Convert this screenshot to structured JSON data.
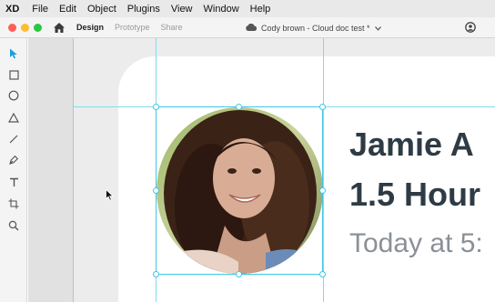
{
  "menubar": {
    "app": "XD",
    "items": [
      "File",
      "Edit",
      "Object",
      "Plugins",
      "View",
      "Window",
      "Help"
    ]
  },
  "header": {
    "tabs": [
      {
        "label": "Design",
        "active": true
      },
      {
        "label": "Prototype",
        "active": false
      },
      {
        "label": "Share",
        "active": false
      }
    ],
    "document_title": "Cody brown - Cloud doc test *"
  },
  "tools": [
    "select-tool",
    "rectangle-tool",
    "ellipse-tool",
    "polygon-tool",
    "line-tool",
    "pen-tool",
    "text-tool",
    "artboard-tool",
    "zoom-tool"
  ],
  "canvas": {
    "title_line1": "Jamie A",
    "title_line2": "1.5 Hour",
    "subtitle": "Today at 5:"
  },
  "colors": {
    "guide": "#7fdcec",
    "selection": "#3ec7e6",
    "title_text": "#2e3b45",
    "subtitle_text": "#8a9096"
  }
}
